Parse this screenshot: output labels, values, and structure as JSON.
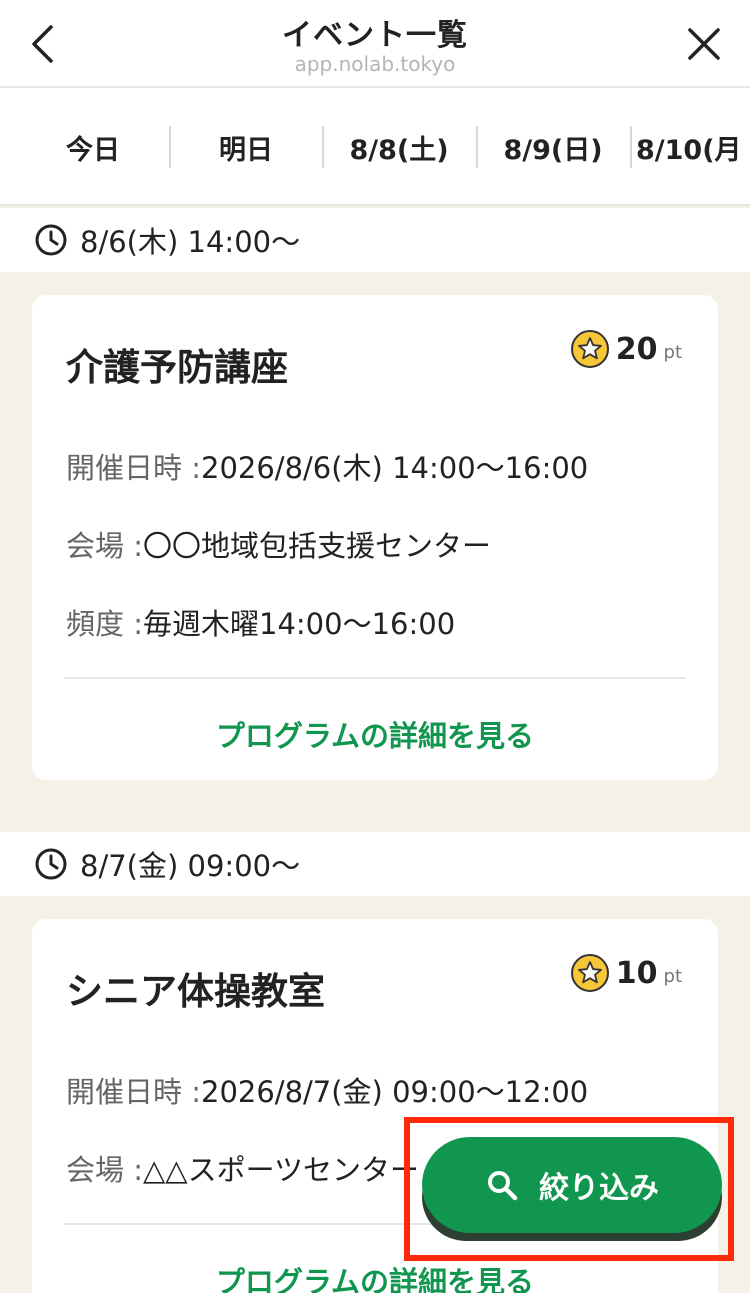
{
  "header": {
    "title": "イベント一覧",
    "url": "app.nolab.tokyo",
    "back_icon": "chevron-left-icon",
    "close_icon": "close-icon"
  },
  "tabs": [
    "今日",
    "明日",
    "8/8(土)",
    "8/9(日)",
    "8/10(月"
  ],
  "events": [
    {
      "time": "8/6(木) 14:00〜",
      "name": "介護予防講座",
      "points": "20",
      "points_unit": "pt",
      "datetime_label": "開催日時 :",
      "datetime": "2026/8/6(木) 14:00〜16:00",
      "venue_label": "会場 :",
      "venue": "〇〇地域包括支援センター",
      "frequency_label": "頻度 :",
      "frequency": "毎週木曜14:00〜16:00",
      "detail_link": "プログラムの詳細を見る"
    },
    {
      "time": "8/7(金) 09:00〜",
      "name": "シニア体操教室",
      "points": "10",
      "points_unit": "pt",
      "datetime_label": "開催日時 :",
      "datetime": "2026/8/7(金) 09:00〜12:00",
      "venue_label": "会場 :",
      "venue": "△△スポーツセンター",
      "detail_link": "プログラムの詳細を見る"
    }
  ],
  "filter_button": {
    "label": "絞り込み",
    "icon": "search-icon"
  },
  "colors": {
    "accent_green": "#11964f",
    "background": "#f5f1e6",
    "highlight_border": "#ff2a0a",
    "star_yellow": "#f7c73a"
  }
}
